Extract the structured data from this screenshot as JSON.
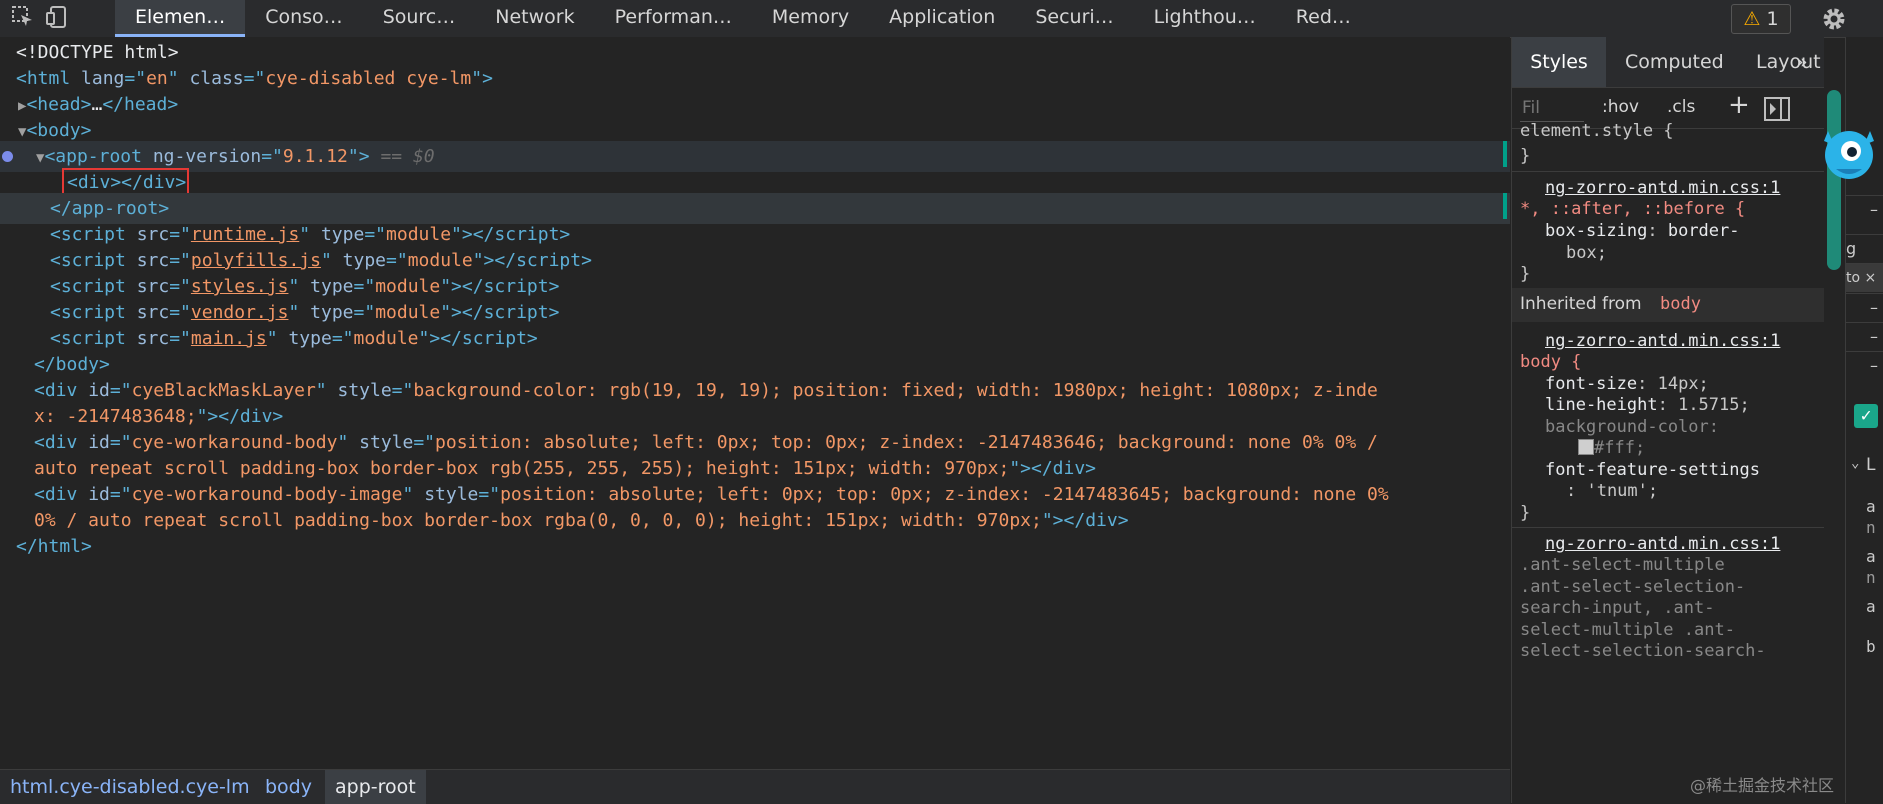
{
  "toolbar": {
    "tabs": [
      {
        "label": "Elemen…",
        "active": true
      },
      {
        "label": "Conso…",
        "active": false
      },
      {
        "label": "Sourc…",
        "active": false
      },
      {
        "label": "Network",
        "active": false
      },
      {
        "label": "Performan…",
        "active": false
      },
      {
        "label": "Memory",
        "active": false
      },
      {
        "label": "Application",
        "active": false
      },
      {
        "label": "Securi…",
        "active": false
      },
      {
        "label": "Lighthou…",
        "active": false
      },
      {
        "label": "Red…",
        "active": false
      }
    ],
    "warning_count": "1"
  },
  "dom": {
    "lines": [
      "<!DOCTYPE html>",
      "<html lang=\"en\" class=\"cye-disabled cye-lm\">",
      "<head>…</head>",
      "<body>",
      "<app-root ng-version=\"9.1.12\">",
      "== $0",
      "<div></div>",
      "</app-root>",
      "runtime.js",
      "polyfills.js",
      "styles.js",
      "vendor.js",
      "main.js",
      "</body>",
      "cyeBlackMaskLayer",
      "background-color: rgb(19, 19, 19); position: fixed; width: 1980px; height: 1080px; z-inde",
      "x: -2147483648;",
      "cye-workaround-body",
      "position: absolute; left: 0px; top: 0px; z-index: -2147483646; background: none 0% 0% /",
      "auto repeat scroll padding-box border-box rgb(255, 255, 255); height: 151px; width: 970px;",
      "cye-workaround-body-image",
      "position: absolute; left: 0px; top: 0px; z-index: -2147483645; background: none 0%",
      "0% / auto repeat scroll padding-box border-box rgba(0, 0, 0, 0); height: 151px; width: 970px;",
      "</html>"
    ]
  },
  "breadcrumbs": [
    "html.cye-disabled.cye-lm",
    "body",
    "app-root"
  ],
  "styles_panel": {
    "tabs": [
      "Styles",
      "Computed",
      "Layout",
      "»"
    ],
    "filter_placeholder": "Fil",
    "hov": ":hov",
    "cls": ".cls",
    "plus": "+",
    "element_style": "element.style {",
    "close_brace": "}",
    "source": "ng-zorro-antd.min.css:1",
    "universal_selector": "*, ::after, ::before {",
    "box_sizing_prop": "box-sizing",
    "box_sizing_val1": "border-",
    "box_sizing_val2": "box;",
    "inherited_from": "Inherited from",
    "inherited_el": "body",
    "body_selector": "body {",
    "font_size_prop": "font-size",
    "font_size_val": "14px;",
    "line_height_prop": "line-height",
    "line_height_val": "1.5715;",
    "bg_prop": "background-color",
    "bg_val": "#fff;",
    "ffs_prop": "font-feature-settings",
    "ffs_val": ": 'tnum';",
    "ant1": ".ant-select-multiple",
    "ant2": ".ant-select-selection-",
    "ant3": "search-input, .ant-",
    "ant4": "select-multiple .ant-",
    "ant5": "select-selection-search-"
  },
  "right_strip": [
    "–",
    "g",
    "to ×",
    "–",
    "–",
    "–",
    "L",
    "a",
    "n",
    "a",
    "n",
    "a",
    "b"
  ],
  "watermark": "@稀土掘金技术社区"
}
